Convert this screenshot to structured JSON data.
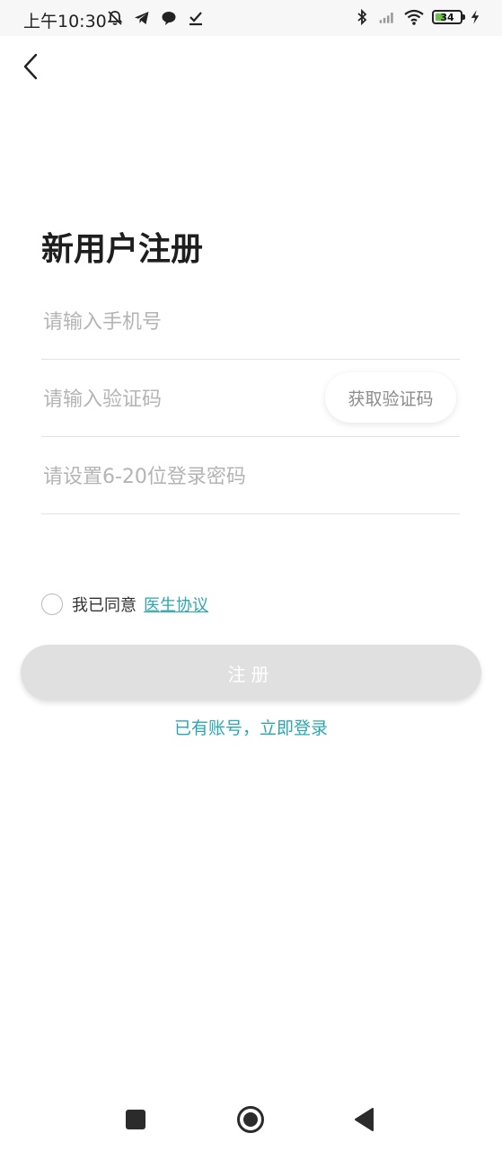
{
  "status_bar": {
    "time": "上午10:30",
    "battery_level": "34",
    "icons_left": [
      "mute-bell-icon",
      "telegram-icon",
      "chat-bubble-icon",
      "download-check-icon"
    ],
    "icons_right": [
      "bluetooth-icon",
      "signal-icon",
      "wifi-icon",
      "battery-icon",
      "charging-icon"
    ]
  },
  "header": {
    "back_icon": "chevron-left-icon"
  },
  "page": {
    "title": "新用户注册"
  },
  "form": {
    "phone_placeholder": "请输入手机号",
    "code_placeholder": "请输入验证码",
    "get_code_label": "获取验证码",
    "password_placeholder": "请设置6-20位登录密码"
  },
  "agreement": {
    "prefix": "我已同意",
    "link_label": "医生协议",
    "checked": false
  },
  "actions": {
    "register_label": "注册",
    "login_link_label": "已有账号，立即登录"
  },
  "colors": {
    "accent": "#2aa7b0",
    "button_disabled": "#e0e0e0",
    "placeholder": "#b4b4b4"
  },
  "nav_bar": {
    "icons": [
      "square-recents-icon",
      "circle-home-icon",
      "triangle-back-icon"
    ]
  }
}
